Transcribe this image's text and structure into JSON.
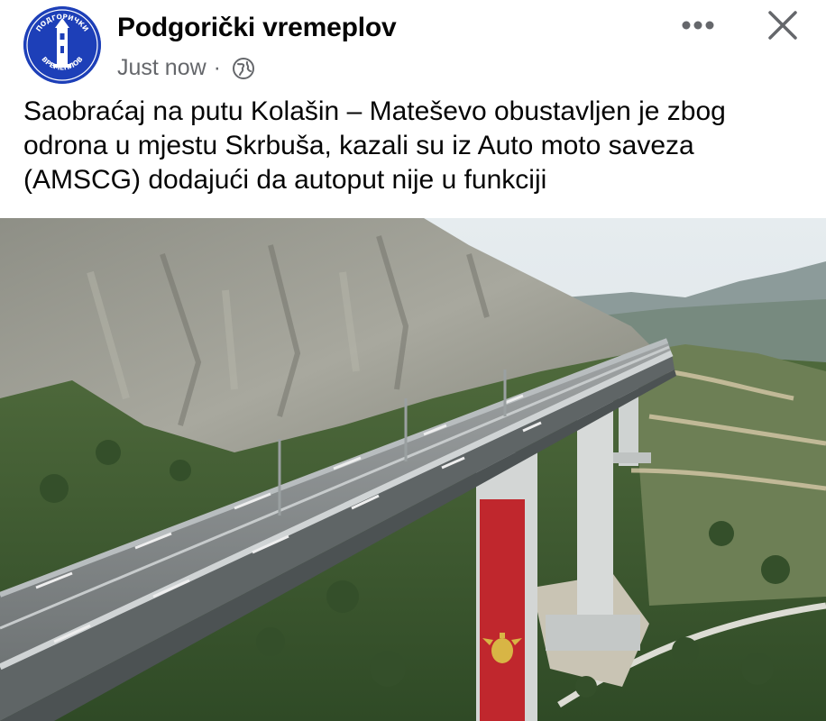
{
  "post": {
    "page_name": "Podgorički vremeplov",
    "timestamp": "Just now",
    "separator": "·",
    "privacy_icon": "globe-icon",
    "more_icon": "more-options-icon",
    "close_icon": "close-icon",
    "avatar": {
      "logo_text_top": "ПОДГОРИЧКИ",
      "logo_text_bottom": "ВРЕМЕПЛОВ",
      "color": "#1d3fb8"
    },
    "text": "Saobraćaj na putu Kolašin – Mateševo obustavljen je zbog odrona u mjestu Skrbuša, kazali su iz Auto moto saveza (AMSCG) dodajući da autoput nije u funkciji"
  },
  "colors": {
    "name_text": "#050505",
    "meta_text": "#65676b",
    "flag_red": "#c0272d"
  }
}
